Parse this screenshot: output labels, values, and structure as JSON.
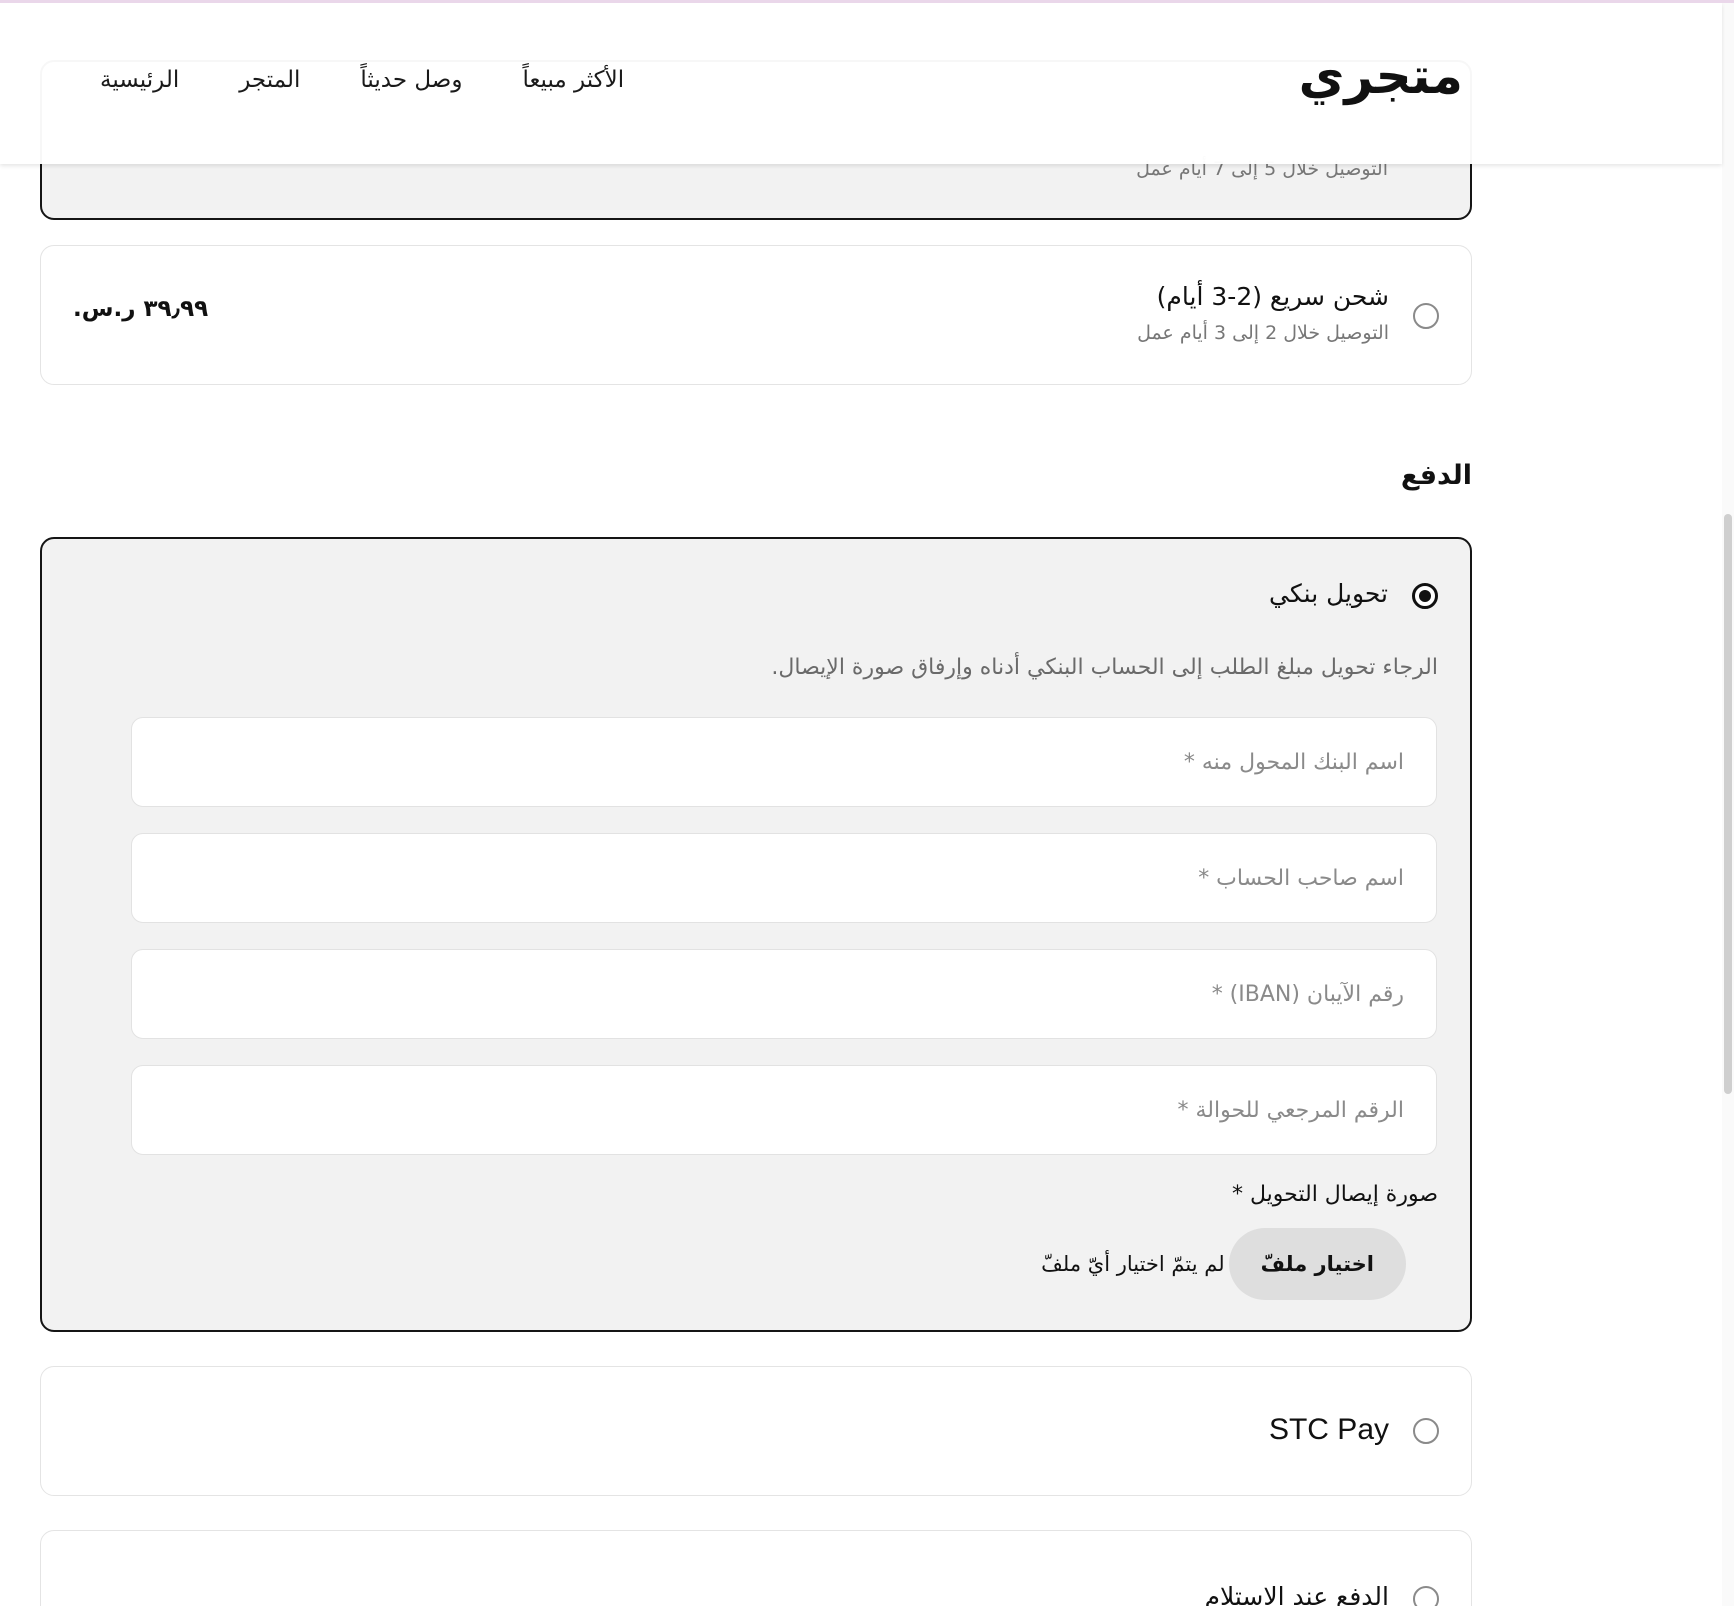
{
  "header": {
    "logo": "متجري",
    "nav": [
      {
        "label": "الرئيسية"
      },
      {
        "label": "المتجر"
      },
      {
        "label": "وصل حديثاً"
      },
      {
        "label": "الأكثر مبيعاً"
      }
    ]
  },
  "shipping": {
    "standard": {
      "subtitle": "التوصيل خلال 5 إلى 7 أيام عمل",
      "selected": true
    },
    "express": {
      "title": "شحن سريع (2-3 أيام)",
      "subtitle": "التوصيل خلال 2 إلى 3 أيام عمل",
      "price": "٣٩٫٩٩ ر.س.",
      "selected": false
    }
  },
  "payment": {
    "section_title": "الدفع",
    "bank_transfer": {
      "title": "تحويل بنكي",
      "selected": true,
      "instructions": "الرجاء تحويل مبلغ الطلب إلى الحساب البنكي أدناه وإرفاق صورة الإيصال.",
      "fields": [
        {
          "placeholder": "اسم البنك المحول منه *",
          "value": ""
        },
        {
          "placeholder": "اسم صاحب الحساب *",
          "value": ""
        },
        {
          "placeholder": "رقم الآيبان (IBAN) *",
          "value": ""
        },
        {
          "placeholder": "الرقم المرجعي للحوالة *",
          "value": ""
        }
      ],
      "upload": {
        "label": "صورة إيصال التحويل *",
        "button": "اختيار ملفّ",
        "status": "لم يتمّ اختيار أيّ ملفّ"
      }
    },
    "stc_pay": {
      "title": "STC Pay",
      "selected": false
    },
    "cod": {
      "title": "الدفع عند الاستلام",
      "selected": false
    }
  }
}
